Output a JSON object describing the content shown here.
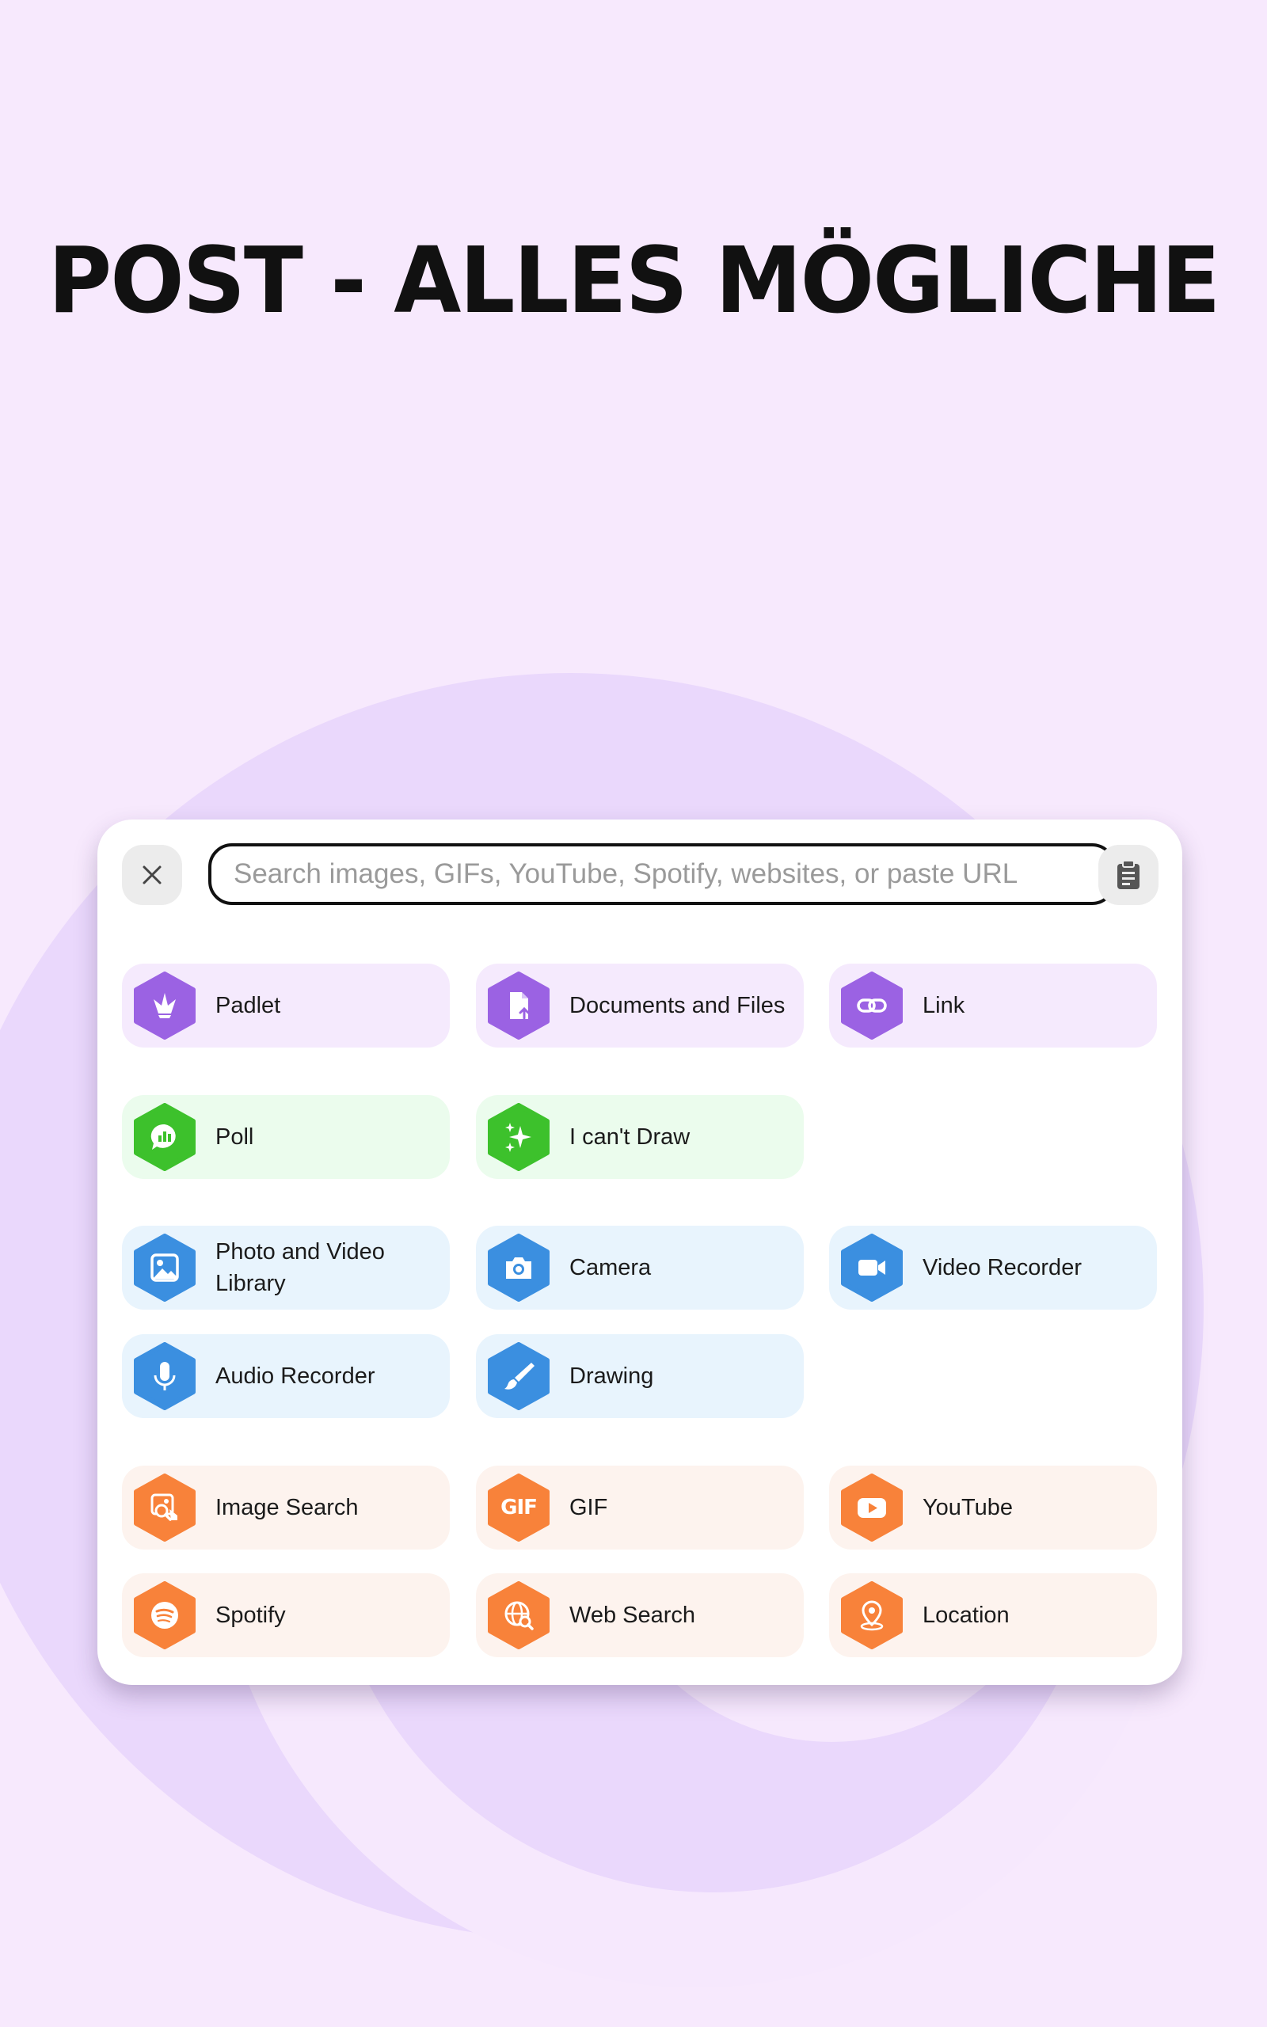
{
  "headline": "POST - ALLES MÖGLICHE",
  "search": {
    "placeholder": "Search images, GIFs, YouTube, Spotify, websites, or paste URL"
  },
  "colors": {
    "purple": "#9b62e3",
    "green": "#3dc12c",
    "blue": "#3b8fe0",
    "orange": "#f8823a"
  },
  "items": {
    "padlet": {
      "label": "Padlet",
      "icon": "padlet-crane-icon"
    },
    "documents": {
      "label": "Documents and Files",
      "icon": "document-upload-icon"
    },
    "link": {
      "label": "Link",
      "icon": "link-icon"
    },
    "poll": {
      "label": "Poll",
      "icon": "poll-chat-icon"
    },
    "cant_draw": {
      "label": "I can't Draw",
      "icon": "sparkles-icon"
    },
    "photo_library": {
      "label": "Photo and Video Library",
      "icon": "image-icon"
    },
    "camera": {
      "label": "Camera",
      "icon": "camera-icon"
    },
    "video_recorder": {
      "label": "Video Recorder",
      "icon": "video-camera-icon"
    },
    "audio_recorder": {
      "label": "Audio Recorder",
      "icon": "microphone-icon"
    },
    "drawing": {
      "label": "Drawing",
      "icon": "brush-icon"
    },
    "image_search": {
      "label": "Image Search",
      "icon": "image-search-icon"
    },
    "gif": {
      "label": "GIF",
      "icon": "gif-icon",
      "badge": "GIF"
    },
    "youtube": {
      "label": "YouTube",
      "icon": "youtube-icon"
    },
    "spotify": {
      "label": "Spotify",
      "icon": "spotify-icon"
    },
    "web_search": {
      "label": "Web Search",
      "icon": "globe-search-icon"
    },
    "location": {
      "label": "Location",
      "icon": "location-pin-icon"
    }
  }
}
